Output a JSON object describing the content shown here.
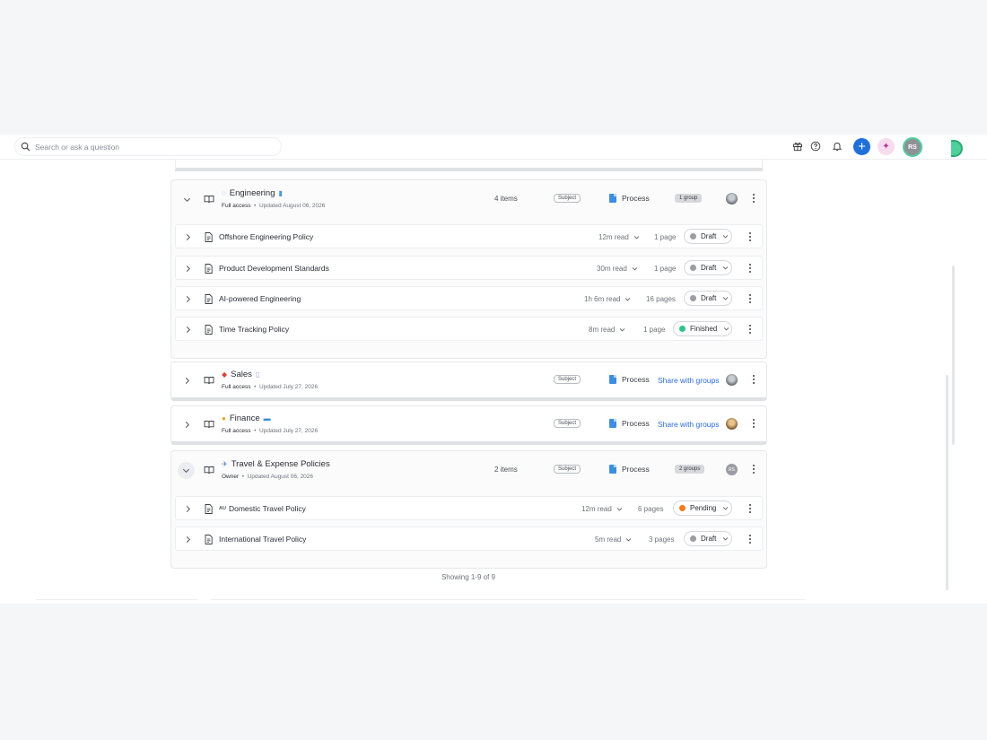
{
  "search": {
    "placeholder": "Search or ask a question"
  },
  "topbar": {
    "avatar_initials": "RS"
  },
  "colors": {
    "accent": "#1f6fd8",
    "draft": "#9a9da3",
    "finished": "#2fc58a",
    "pending": "#f07a1c",
    "link": "#2c6dd2"
  },
  "groups": {
    "engineering": {
      "title": "Engineering",
      "access": "Full access",
      "updated": "Updated August 06, 2026",
      "items": "4 items",
      "subject": "Subject",
      "process": "Process",
      "badge": "1 group",
      "docs": [
        {
          "title": "Offshore Engineering Policy",
          "read": "12m read",
          "pages": "1 page",
          "status": "Draft"
        },
        {
          "title": "Product Development Standards",
          "read": "30m read",
          "pages": "1 page",
          "status": "Draft"
        },
        {
          "title": "AI-powered Engineering",
          "read": "1h 6m read",
          "pages": "16 pages",
          "status": "Draft"
        },
        {
          "title": "Time Tracking Policy",
          "read": "8m read",
          "pages": "1 page",
          "status": "Finished"
        }
      ]
    },
    "sales": {
      "title": "Sales",
      "access": "Full access",
      "updated": "Updated July 27, 2026",
      "subject": "Subject",
      "process": "Process",
      "share": "Share with groups"
    },
    "finance": {
      "title": "Finance",
      "access": "Full access",
      "updated": "Updated July 27, 2026",
      "subject": "Subject",
      "process": "Process",
      "share": "Share with groups"
    },
    "travel": {
      "title": "Travel & Expense Policies",
      "access": "Owner",
      "updated": "Updated August 06, 2026",
      "items": "2 items",
      "subject": "Subject",
      "process": "Process",
      "badge": "2 groups",
      "avatar_initials": "RS",
      "docs": [
        {
          "prefix": "AU",
          "title": "Domestic Travel Policy",
          "read": "12m read",
          "pages": "6 pages",
          "status": "Pending"
        },
        {
          "title": "International Travel Policy",
          "read": "5m read",
          "pages": "3 pages",
          "status": "Draft"
        }
      ]
    }
  },
  "footer": {
    "showing": "Showing 1-9 of 9"
  }
}
